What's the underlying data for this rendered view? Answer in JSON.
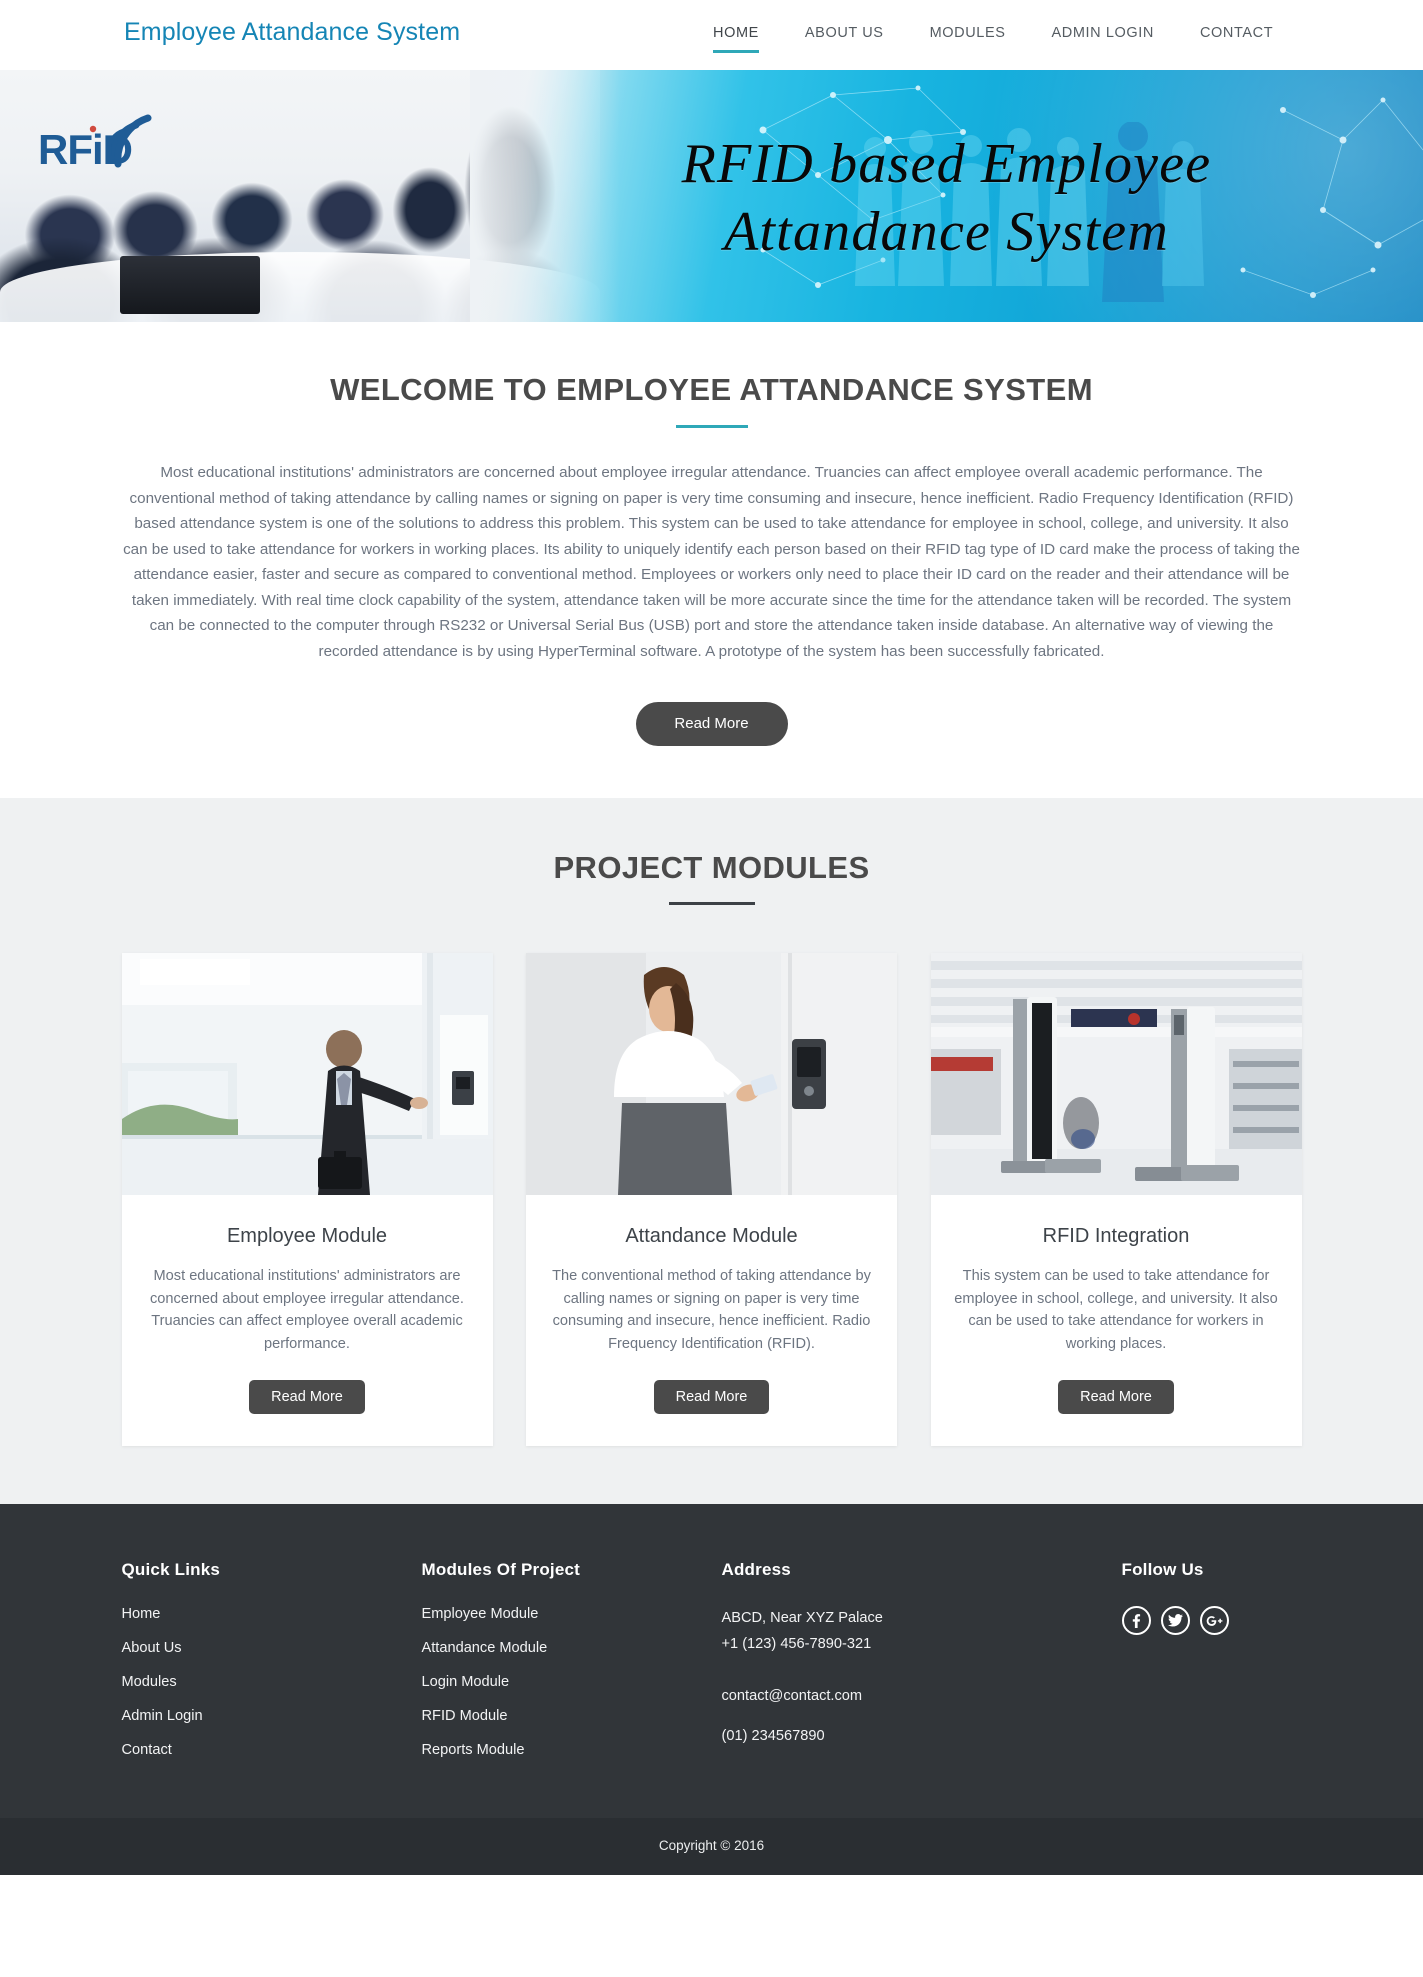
{
  "header": {
    "brand": "Employee Attandance System",
    "nav": [
      {
        "label": "HOME",
        "active": true
      },
      {
        "label": "ABOUT US",
        "active": false
      },
      {
        "label": "MODULES",
        "active": false
      },
      {
        "label": "ADMIN LOGIN",
        "active": false
      },
      {
        "label": "CONTACT",
        "active": false
      }
    ]
  },
  "hero": {
    "title_line1": "RFID based Employee",
    "title_line2": "Attandance System",
    "badge_text": "RFID"
  },
  "welcome": {
    "title": "WELCOME TO EMPLOYEE ATTANDANCE SYSTEM",
    "body": "Most educational institutions' administrators are concerned about employee irregular attendance. Truancies can affect employee overall academic performance. The conventional method of taking attendance by calling names or signing on paper is very time consuming and insecure, hence inefficient. Radio Frequency Identification (RFID) based attendance system is one of the solutions to address this problem. This system can be used to take attendance for employee in school, college, and university. It also can be used to take attendance for workers in working places. Its ability to uniquely identify each person based on their RFID tag type of ID card make the process of taking the attendance easier, faster and secure as compared to conventional method. Employees or workers only need to place their ID card on the reader and their attendance will be taken immediately. With real time clock capability of the system, attendance taken will be more accurate since the time for the attendance taken will be recorded. The system can be connected to the computer through RS232 or Universal Serial Bus (USB) port and store the attendance taken inside database. An alternative way of viewing the recorded attendance is by using HyperTerminal software. A prototype of the system has been successfully fabricated.",
    "read_more": "Read More"
  },
  "modules": {
    "title": "PROJECT MODULES",
    "cards": [
      {
        "title": "Employee Module",
        "text": "Most educational institutions' administrators are concerned about employee irregular attendance. Truancies can affect employee overall academic performance.",
        "button": "Read More",
        "image_alt": "businessman-badging-at-door-reader"
      },
      {
        "title": "Attandance Module",
        "text": "The conventional method of taking attendance by calling names or signing on paper is very time consuming and insecure, hence inefficient. Radio Frequency Identification (RFID).",
        "button": "Read More",
        "image_alt": "woman-scanning-card-at-wall-reader"
      },
      {
        "title": "RFID Integration",
        "text": "This system can be used to take attendance for employee in school, college, and university. It also can be used to take attendance for workers in working places.",
        "button": "Read More",
        "image_alt": "rfid-gate-pedestals-in-store"
      }
    ]
  },
  "footer": {
    "quick_links": {
      "title": "Quick Links",
      "items": [
        "Home",
        "About Us",
        "Modules",
        "Admin Login",
        "Contact"
      ]
    },
    "modules_of_project": {
      "title": "Modules Of Project",
      "items": [
        "Employee Module",
        "Attandance Module",
        "Login Module",
        "RFID Module",
        "Reports Module"
      ]
    },
    "address": {
      "title": "Address",
      "line1": "ABCD, Near XYZ Palace",
      "line2": "+1 (123) 456-7890-321",
      "email": "contact@contact.com",
      "phone": "(01) 234567890"
    },
    "follow": {
      "title": "Follow Us",
      "icons": [
        "facebook-icon",
        "twitter-icon",
        "google-plus-icon"
      ]
    },
    "copyright": "Copyright © 2016"
  },
  "colors": {
    "brand_teal": "#1585b5",
    "accent_teal": "#2fa8b8",
    "dark": "#4a4a4a",
    "footer_bg": "#313539",
    "copyright_bg": "#2a2e32",
    "modules_bg": "#eff1f2"
  }
}
